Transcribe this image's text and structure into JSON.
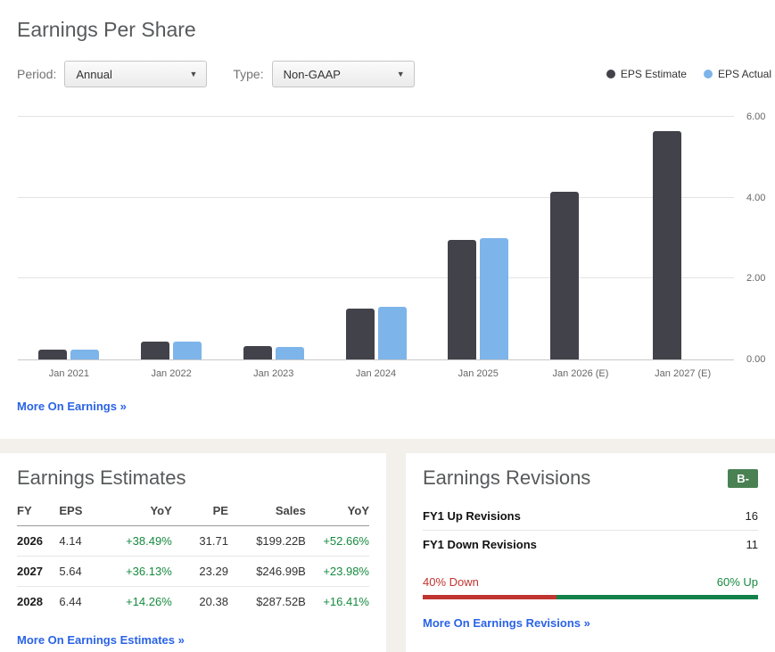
{
  "header": {
    "title": "Earnings Per Share"
  },
  "controls": {
    "period_label": "Period:",
    "period_value": "Annual",
    "type_label": "Type:",
    "type_value": "Non-GAAP",
    "dropdown_arrow": "▼"
  },
  "legend": [
    {
      "label": "EPS Estimate",
      "color": "#42424a"
    },
    {
      "label": "EPS Actual",
      "color": "#7db4ea"
    }
  ],
  "chart_data": {
    "type": "bar",
    "title": "Earnings Per Share",
    "categories": [
      "Jan 2021",
      "Jan 2022",
      "Jan 2023",
      "Jan 2024",
      "Jan 2025",
      "Jan 2026 (E)",
      "Jan 2027 (E)"
    ],
    "series": [
      {
        "name": "EPS Estimate",
        "color": "#42424a",
        "values": [
          0.24,
          0.44,
          0.33,
          1.26,
          2.95,
          4.14,
          5.64
        ]
      },
      {
        "name": "EPS Actual",
        "color": "#7db4ea",
        "values": [
          0.25,
          0.45,
          0.32,
          1.3,
          2.99,
          null,
          null
        ]
      }
    ],
    "xlabel": "",
    "ylabel": "",
    "ylim": [
      0,
      6
    ],
    "yticks": [
      {
        "value": 0,
        "label": "0.00"
      },
      {
        "value": 2,
        "label": "2.00"
      },
      {
        "value": 4,
        "label": "4.00"
      },
      {
        "value": 6,
        "label": "6.00"
      }
    ],
    "grid": true,
    "legend_position": "top-right"
  },
  "links": {
    "more_earnings": "More On Earnings »",
    "more_estimates": "More On Earnings Estimates »",
    "more_revisions": "More On Earnings Revisions »"
  },
  "estimates": {
    "title": "Earnings Estimates",
    "table": {
      "headers": [
        "FY",
        "EPS",
        "YoY",
        "PE",
        "Sales",
        "YoY"
      ],
      "rows": [
        {
          "fy": "2026",
          "eps": "4.14",
          "yoy": "+38.49%",
          "pe": "31.71",
          "sales": "$199.22B",
          "sales_yoy": "+52.66%"
        },
        {
          "fy": "2027",
          "eps": "5.64",
          "yoy": "+36.13%",
          "pe": "23.29",
          "sales": "$246.99B",
          "sales_yoy": "+23.98%"
        },
        {
          "fy": "2028",
          "eps": "6.44",
          "yoy": "+14.26%",
          "pe": "20.38",
          "sales": "$287.52B",
          "sales_yoy": "+16.41%"
        }
      ]
    }
  },
  "revisions": {
    "title": "Earnings Revisions",
    "grade": "B-",
    "rows": [
      {
        "label": "FY1 Up Revisions",
        "value": "16"
      },
      {
        "label": "FY1 Down Revisions",
        "value": "11"
      }
    ],
    "down_label": "40% Down",
    "up_label": "60% Up",
    "down_pct": 40,
    "up_pct": 60
  },
  "colors": {
    "link": "#2a63e6",
    "green": "#178a3f",
    "red": "#c13531",
    "bar_green": "#12814a",
    "badge_bg": "#4a8153",
    "band_bg": "#f3f0ec"
  }
}
